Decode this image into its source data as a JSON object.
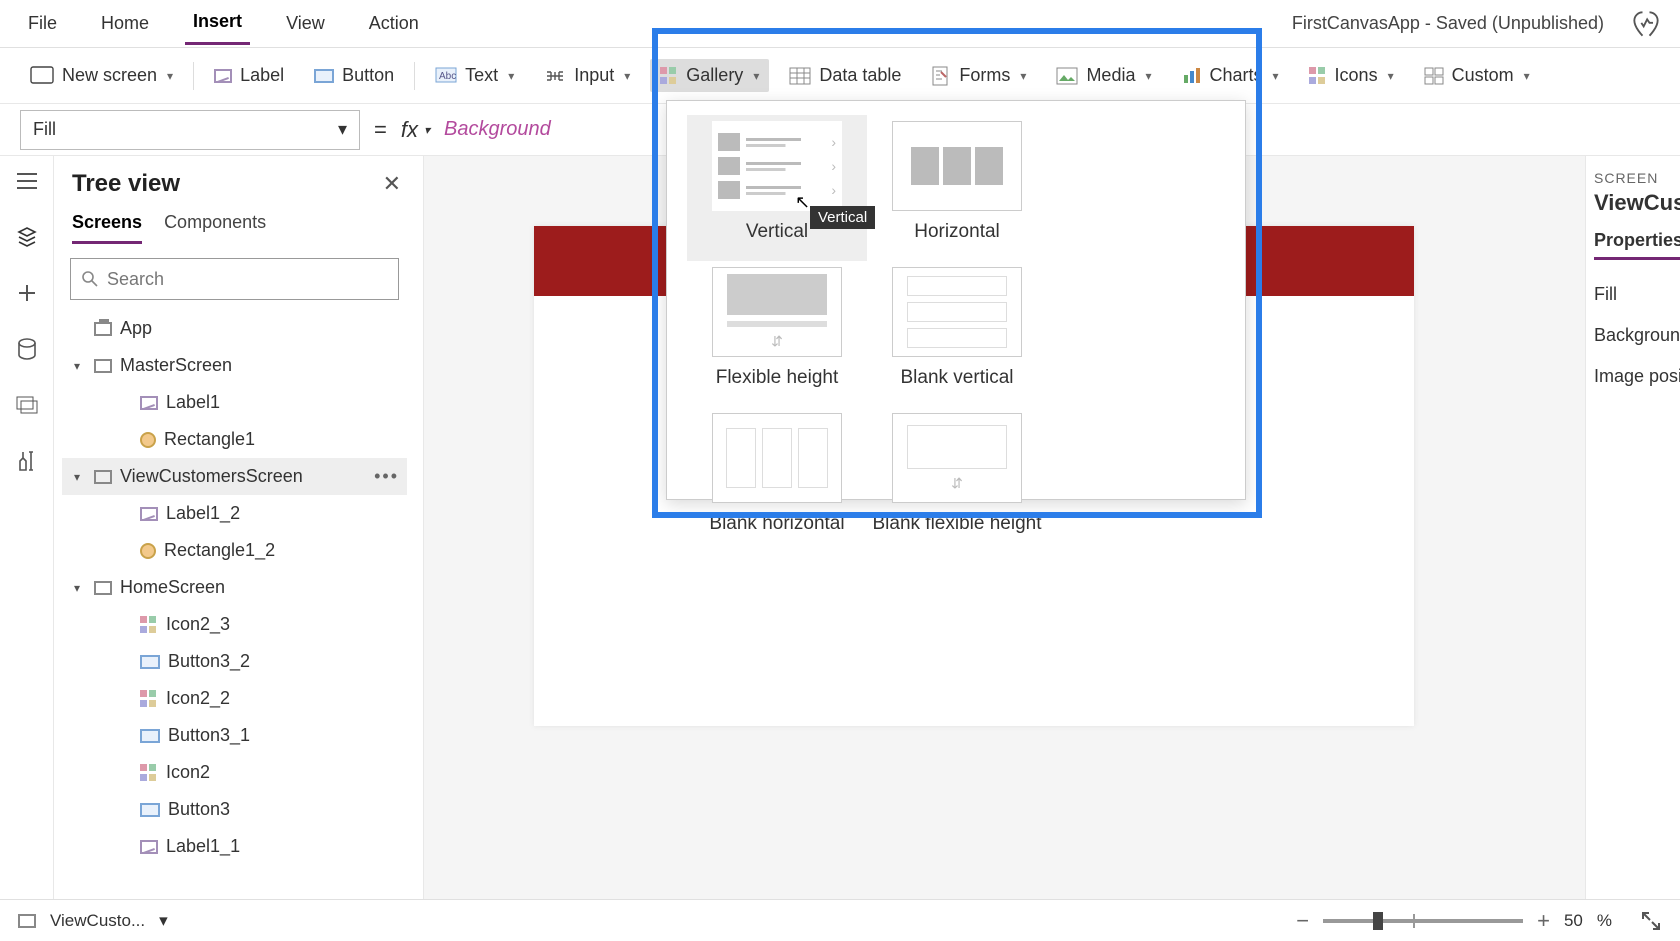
{
  "menubar": {
    "items": [
      "File",
      "Home",
      "Insert",
      "View",
      "Action"
    ],
    "active": "Insert"
  },
  "app_status": "FirstCanvasApp - Saved (Unpublished)",
  "ribbon": {
    "new_screen": "New screen",
    "label": "Label",
    "button": "Button",
    "text": "Text",
    "input": "Input",
    "gallery": "Gallery",
    "data_table": "Data table",
    "forms": "Forms",
    "media": "Media",
    "charts": "Charts",
    "icons": "Icons",
    "custom": "Custom"
  },
  "formula": {
    "property": "Fill",
    "fx": "fx",
    "expression": "Background"
  },
  "treeview": {
    "title": "Tree view",
    "tabs": {
      "screens": "Screens",
      "components": "Components"
    },
    "search_placeholder": "Search",
    "nodes": {
      "app": "App",
      "master": "MasterScreen",
      "master_children": [
        "Label1",
        "Rectangle1"
      ],
      "viewcust": "ViewCustomersScreen",
      "viewcust_children": [
        "Label1_2",
        "Rectangle1_2"
      ],
      "home": "HomeScreen",
      "home_children": [
        "Icon2_3",
        "Button3_2",
        "Icon2_2",
        "Button3_1",
        "Icon2",
        "Button3",
        "Label1_1"
      ]
    }
  },
  "gallery_popup": {
    "tooltip": "Vertical",
    "items": [
      "Vertical",
      "Horizontal",
      "Flexible height",
      "Blank vertical",
      "Blank horizontal",
      "Blank flexible height"
    ]
  },
  "properties": {
    "section_label": "SCREEN",
    "screen_name": "ViewCusto",
    "tab": "Properties",
    "rows": [
      "Fill",
      "Background",
      "Image posit"
    ]
  },
  "statusbar": {
    "screen": "ViewCusto...",
    "zoom": "50",
    "pct": "%"
  }
}
